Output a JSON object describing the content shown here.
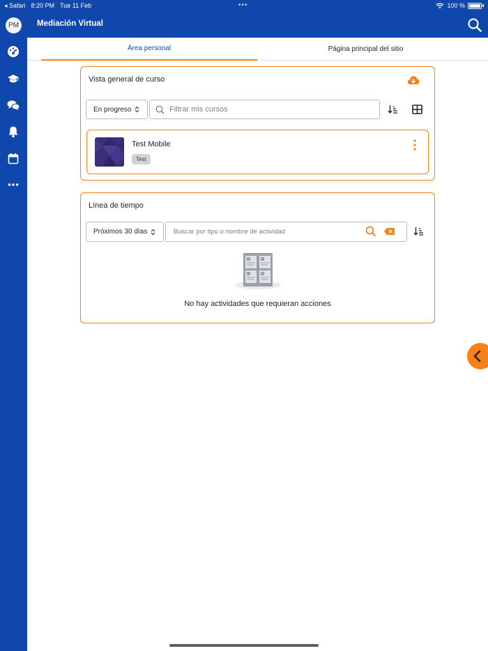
{
  "status_bar": {
    "back_app": "◂ Safari",
    "time": "8:20 PM",
    "date": "Tue 11 Feb",
    "dots": "•••",
    "battery": "100 %"
  },
  "sidebar": {
    "avatar_initials": "PM",
    "items": [
      {
        "icon": "dashboard-icon"
      },
      {
        "icon": "graduation-cap-icon"
      },
      {
        "icon": "messages-icon"
      },
      {
        "icon": "bell-icon"
      },
      {
        "icon": "calendar-icon"
      },
      {
        "icon": "more-icon"
      }
    ]
  },
  "header": {
    "title": "Mediación Virtual",
    "search_icon": "search-icon"
  },
  "tabs": [
    {
      "label": "Área personal",
      "active": true
    },
    {
      "label": "Página principal del sitio",
      "active": false
    }
  ],
  "course_overview": {
    "title": "Vista general de curso",
    "filter_select": "En progreso",
    "search_placeholder": "Filtrar mis cursos",
    "courses": [
      {
        "name": "Test Mobile",
        "category": "Test"
      }
    ]
  },
  "timeline": {
    "title": "Línea de tiempo",
    "range_select": "Próximos 30 días",
    "search_placeholder": "Buscar por tipo o nombre de actividad",
    "empty_message": "No hay actividades que requieran acciones"
  },
  "colors": {
    "brand": "#0f47ad",
    "accent": "#f98012"
  }
}
